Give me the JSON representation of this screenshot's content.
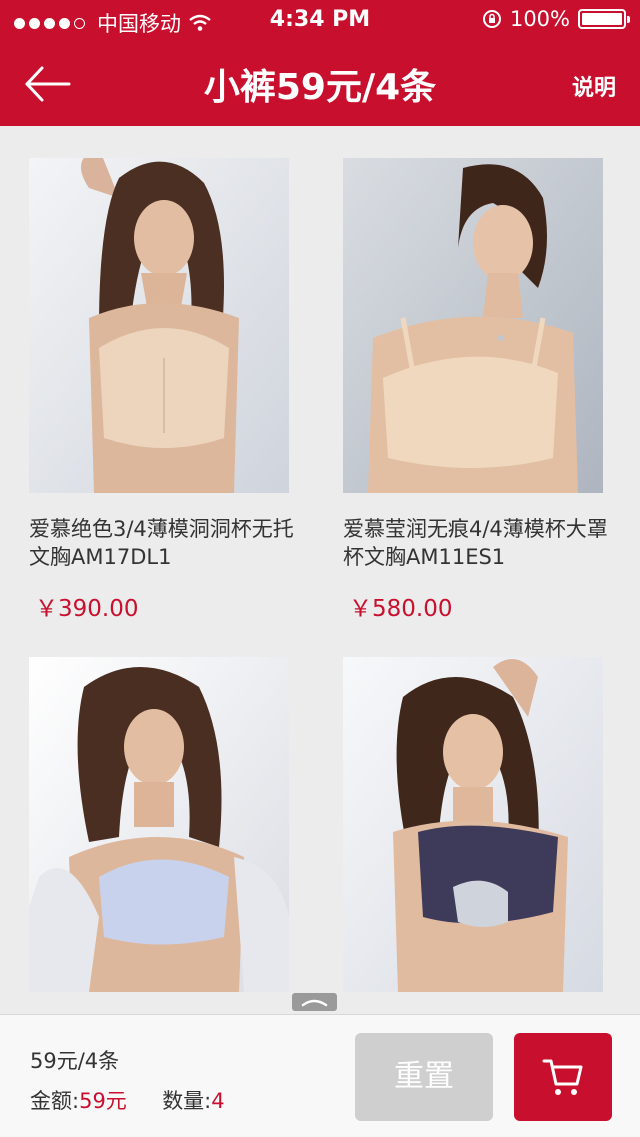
{
  "status_bar": {
    "carrier": "中国移动",
    "time": "4:34 PM",
    "battery": "100%"
  },
  "nav": {
    "title": "小裤59元/4条",
    "help_label": "说明"
  },
  "products": [
    {
      "name": "爱慕绝色3/4薄模洞洞杯无托文胸AM17DL1",
      "price": "￥390.00",
      "bra_color": "#ecd4bd"
    },
    {
      "name": "爱慕莹润无痕4/4薄模杯大罩杯文胸AM11ES1",
      "price": "￥580.00",
      "bra_color": "#f0d8bf"
    },
    {
      "name": "",
      "price": "",
      "bra_color": "#c9d2ec"
    },
    {
      "name": "",
      "price": "",
      "bra_color": "#3e3a5a"
    }
  ],
  "bottom_bar": {
    "summary": "59元/4条",
    "amount_label": "金额:",
    "amount_value": "59元",
    "quantity_label": "数量:",
    "quantity_value": "4",
    "reset_label": "重置"
  },
  "colors": {
    "accent": "#c8102e",
    "background": "#ececec",
    "reset_button": "#cfcfcf"
  },
  "icons": [
    "back-arrow-icon",
    "wifi-icon",
    "rotation-lock-icon",
    "battery-icon",
    "cart-icon",
    "chevron-up-icon"
  ]
}
